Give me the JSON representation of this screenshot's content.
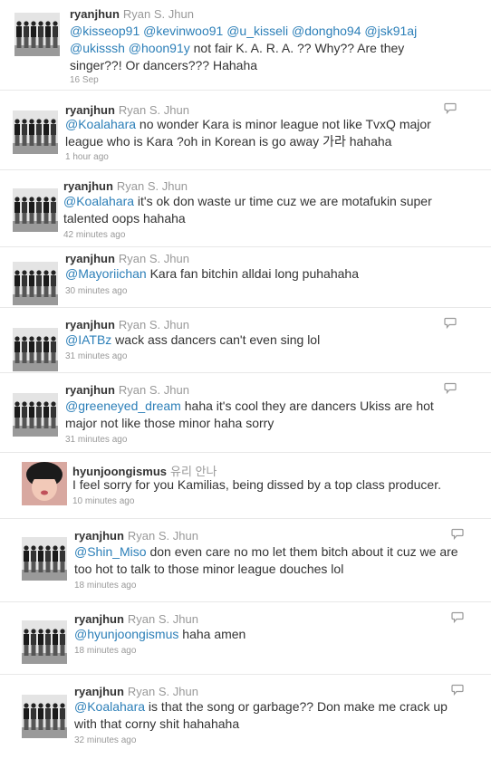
{
  "tweets": [
    {
      "username": "ryanjhun",
      "realname": "Ryan S. Jhun",
      "line1": [
        {
          "t": "@kisseop91",
          "m": true
        },
        {
          "t": " "
        },
        {
          "t": "@kevinwoo91",
          "m": true
        },
        {
          "t": " "
        },
        {
          "t": "@u_kisseli",
          "m": true
        },
        {
          "t": " "
        },
        {
          "t": "@dongho94",
          "m": true
        },
        {
          "t": " "
        },
        {
          "t": "@jsk91aj",
          "m": true
        }
      ],
      "line2": [
        {
          "t": "@ukisssh",
          "m": true
        },
        {
          "t": " "
        },
        {
          "t": "@hoon91y",
          "m": true
        },
        {
          "t": " not fair K. A. R. A. ?? Why?? Are they"
        }
      ],
      "line3": [
        {
          "t": "singer??! Or dancers??? Hahaha"
        }
      ],
      "time": "16 Sep",
      "avatar": "group",
      "reply": false
    },
    {
      "username": "ryanjhun",
      "realname": "Ryan S. Jhun",
      "line1": [
        {
          "t": "@Koalahara",
          "m": true
        },
        {
          "t": " no wonder Kara is minor league not like TvxQ major"
        }
      ],
      "line2": [
        {
          "t": "league who is Kara ?oh in Korean is go away 가라 hahaha"
        }
      ],
      "time": "1 hour ago",
      "avatar": "group",
      "reply": true
    },
    {
      "username": "ryanjhun",
      "realname": "Ryan S. Jhun",
      "line1": [
        {
          "t": "@Koalahara",
          "m": true
        },
        {
          "t": " it's ok don waste ur time cuz we are motafukin super"
        }
      ],
      "line2": [
        {
          "t": "talented oops hahaha"
        }
      ],
      "time": "42 minutes ago",
      "avatar": "group",
      "reply": false
    },
    {
      "username": "ryanjhun",
      "realname": "Ryan S. Jhun",
      "line1": [
        {
          "t": "@Mayoriichan",
          "m": true
        },
        {
          "t": " Kara fan bitchin alldai long puhahaha"
        }
      ],
      "time": "30 minutes ago",
      "avatar": "group",
      "reply": false
    },
    {
      "username": "ryanjhun",
      "realname": "Ryan S. Jhun",
      "line1": [
        {
          "t": "@IATBz",
          "m": true
        },
        {
          "t": " wack ass dancers can't even sing lol"
        }
      ],
      "time": "31 minutes ago",
      "avatar": "group",
      "reply": true
    },
    {
      "username": "ryanjhun",
      "realname": "Ryan S. Jhun",
      "line1": [
        {
          "t": "@greeneyed_dream",
          "m": true
        },
        {
          "t": " haha it's cool they are dancers Ukiss are hot"
        }
      ],
      "line2": [
        {
          "t": "major not like those minor haha sorry"
        }
      ],
      "time": "31 minutes ago",
      "avatar": "group",
      "reply": true
    },
    {
      "username": "hyunjoongismus",
      "realname": "유리 안나",
      "line1": [
        {
          "t": "I feel sorry for you Kamilias, being dissed by a top class producer."
        }
      ],
      "time": "10 minutes ago",
      "avatar": "person",
      "reply": false
    },
    {
      "username": "ryanjhun",
      "realname": "Ryan S. Jhun",
      "line1": [
        {
          "t": "@Shin_Miso",
          "m": true
        },
        {
          "t": " don even care no mo let them bitch about it cuz we are"
        }
      ],
      "line2": [
        {
          "t": "too hot to talk to those minor league douches lol"
        }
      ],
      "time": "18 minutes ago",
      "avatar": "group",
      "reply": true
    },
    {
      "username": "ryanjhun",
      "realname": "Ryan S. Jhun",
      "line1": [
        {
          "t": "@hyunjoongismus",
          "m": true
        },
        {
          "t": " haha amen"
        }
      ],
      "time": "18 minutes ago",
      "avatar": "group",
      "reply": true
    },
    {
      "username": "ryanjhun",
      "realname": "Ryan S. Jhun",
      "line1": [
        {
          "t": "@Koalahara",
          "m": true
        },
        {
          "t": " is that the song or garbage?? Don make me crack up"
        }
      ],
      "line2": [
        {
          "t": "with that corny shit hahahaha"
        }
      ],
      "time": "32 minutes ago",
      "avatar": "group",
      "reply": true
    }
  ],
  "colors": {
    "mention": "#2c7fb8",
    "username": "#333333",
    "meta": "#999999"
  }
}
